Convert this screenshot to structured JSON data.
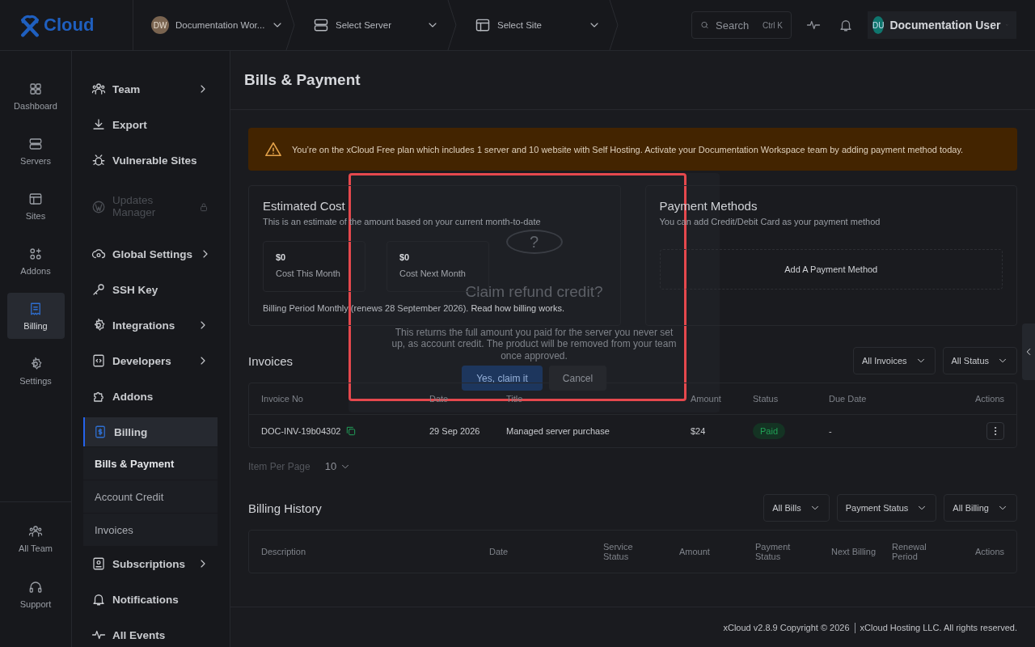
{
  "topbar": {
    "brand": "Cloud",
    "breadcrumbs": [
      {
        "kind": "workspace",
        "avatar": "DW",
        "label": "Documentation Wor..."
      },
      {
        "kind": "server",
        "label": "Select Server"
      },
      {
        "kind": "site",
        "label": "Select Site"
      }
    ],
    "search": {
      "placeholder": "Search",
      "shortcut": "Ctrl K"
    },
    "user": {
      "initials": "DU",
      "name": "Documentation User"
    }
  },
  "rail": {
    "items": [
      {
        "label": "Dashboard",
        "selected": false
      },
      {
        "label": "Servers",
        "selected": false
      },
      {
        "label": "Sites",
        "selected": false
      },
      {
        "label": "Addons",
        "selected": false
      },
      {
        "label": "Billing",
        "selected": true
      },
      {
        "label": "Settings",
        "selected": false
      }
    ],
    "bottom_items": [
      {
        "label": "All Team",
        "selected": false
      },
      {
        "label": "Support",
        "selected": false
      }
    ]
  },
  "sidebar": {
    "items": [
      {
        "label": "Team",
        "expandable": true,
        "disabled": false,
        "selected": false
      },
      {
        "label": "Export",
        "expandable": false,
        "disabled": false,
        "selected": false
      },
      {
        "label": "Vulnerable Sites",
        "expandable": false,
        "disabled": false,
        "selected": false
      },
      {
        "label": "Updates Manager",
        "expandable": false,
        "disabled": true,
        "selected": false
      },
      {
        "label": "Global Settings",
        "expandable": true,
        "disabled": false,
        "selected": false
      },
      {
        "label": "SSH Key",
        "expandable": false,
        "disabled": false,
        "selected": false
      },
      {
        "label": "Integrations",
        "expandable": true,
        "disabled": false,
        "selected": false
      },
      {
        "label": "Developers",
        "expandable": true,
        "disabled": false,
        "selected": false
      },
      {
        "label": "Addons",
        "expandable": false,
        "disabled": false,
        "selected": false
      },
      {
        "label": "Billing",
        "expandable": false,
        "disabled": false,
        "selected": true,
        "children": [
          {
            "label": "Bills & Payment",
            "selected": true
          },
          {
            "label": "Account Credit",
            "selected": false
          },
          {
            "label": "Invoices",
            "selected": false
          }
        ]
      },
      {
        "label": "Subscriptions",
        "expandable": true,
        "disabled": false,
        "selected": false
      },
      {
        "label": "Notifications",
        "expandable": false,
        "disabled": false,
        "selected": false
      },
      {
        "label": "All Events",
        "expandable": false,
        "disabled": false,
        "selected": false
      }
    ]
  },
  "page_title": "Bills & Payment",
  "alert": "You’re on the xCloud Free plan which includes 1 server and 10 website with Self Hosting. Activate your Documentation Workspace team by adding payment method today.",
  "estimated_cost": {
    "title": "Estimated Cost",
    "description": "This is an estimate of the amount based on your current month-to-date",
    "cards": [
      {
        "amount": "$0",
        "label": "Cost This Month"
      },
      {
        "amount": "$0",
        "label": "Cost Next Month"
      }
    ],
    "period": "Billing Period Monthly (renews 28 September 2026).",
    "link": "Read how billing works."
  },
  "payment_methods": {
    "title": "Payment Methods",
    "description": "You can add Credit/Debit Card as your payment method",
    "button": "Add A Payment Method"
  },
  "invoices": {
    "title": "Invoices",
    "filters": [
      "All Invoices",
      "All Status"
    ],
    "columns": [
      "Invoice No",
      "Date",
      "Title",
      "Amount",
      "Status",
      "Due Date",
      "Actions"
    ],
    "rows": [
      {
        "invoice_no": "DOC-INV-19b04302",
        "date": "29 Sep 2026",
        "title": "Managed server purchase",
        "amount": "$24",
        "status": "Paid",
        "due_date": "-"
      }
    ],
    "per_page_label": "Item Per Page",
    "per_page": "10"
  },
  "billing_history": {
    "title": "Billing History",
    "filters": [
      "All Bills",
      "Payment Status",
      "All Billing"
    ],
    "columns": [
      "Description",
      "Date",
      "Service Status",
      "Amount",
      "Payment Status",
      "Next Billing",
      "Renewal Period",
      "Actions"
    ]
  },
  "footer": {
    "version": "xCloud v2.8.9 Copyright © 2026",
    "company": "xCloud Hosting LLC. All rights reserved."
  },
  "dialog": {
    "icon": "?",
    "title": "Claim refund credit?",
    "message": "This returns the full amount you paid for the server you never set up, as account credit. The product will be removed from your team once approved.",
    "confirm": "Yes, claim it",
    "cancel": "Cancel"
  }
}
